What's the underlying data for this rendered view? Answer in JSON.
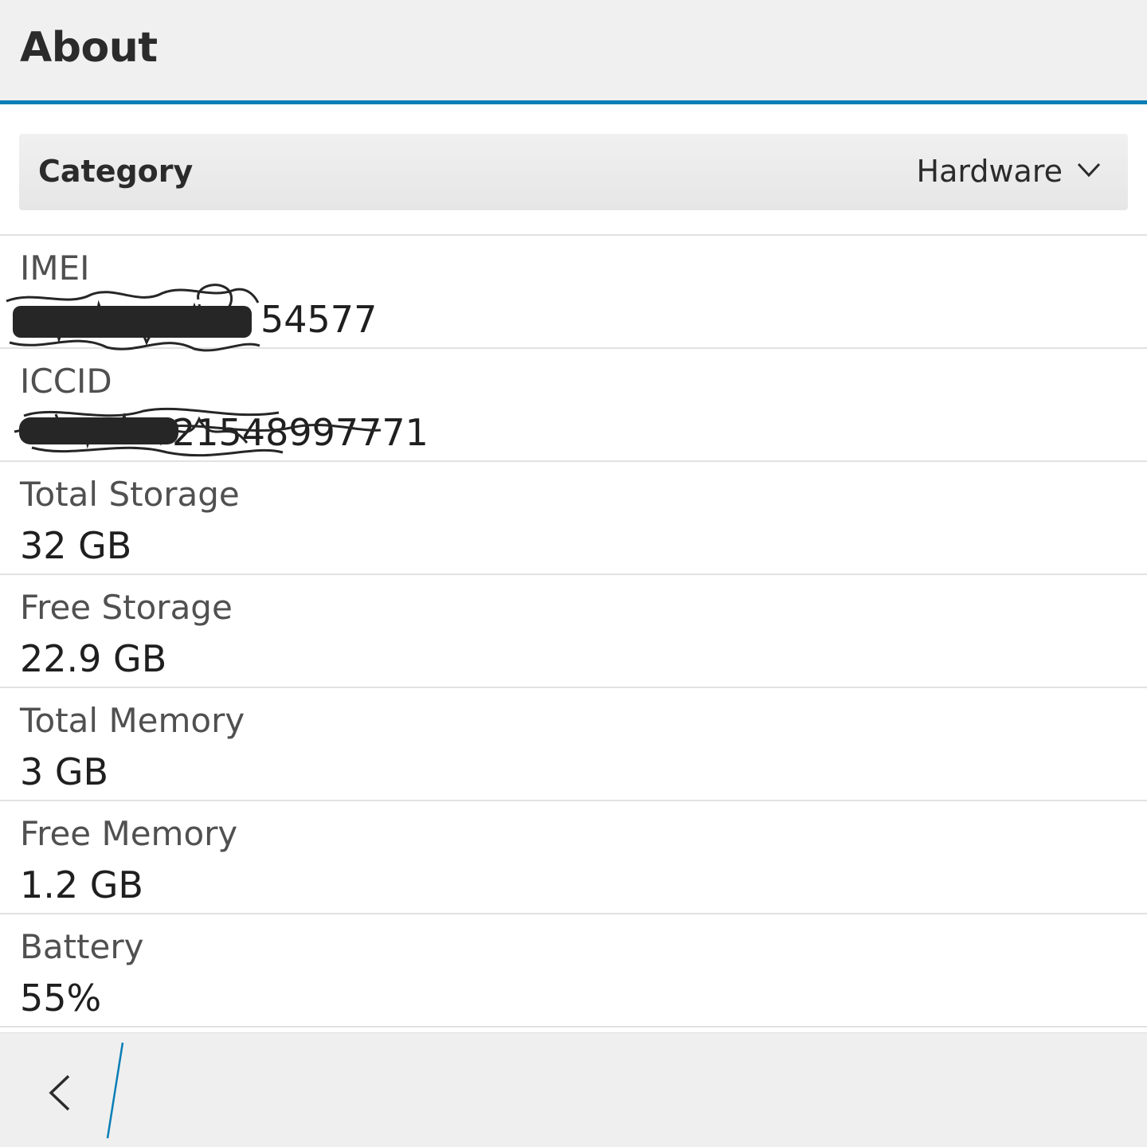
{
  "header": {
    "title": "About",
    "accent_color": "#0a7eb6"
  },
  "category": {
    "label": "Category",
    "selected": "Hardware",
    "icon": "chevron-down-icon"
  },
  "rows": [
    {
      "label": "IMEI",
      "value": "54577",
      "redacted": true
    },
    {
      "label": "ICCID",
      "value": "21548997771",
      "redacted": true
    },
    {
      "label": "Total Storage",
      "value": "32 GB"
    },
    {
      "label": "Free Storage",
      "value": "22.9 GB"
    },
    {
      "label": "Total Memory",
      "value": "3 GB"
    },
    {
      "label": "Free Memory",
      "value": "1.2 GB"
    },
    {
      "label": "Battery",
      "value": "55%"
    }
  ],
  "action_bar": {
    "back_icon": "back-arrow-icon",
    "divider_color": "#0a7eb6"
  }
}
